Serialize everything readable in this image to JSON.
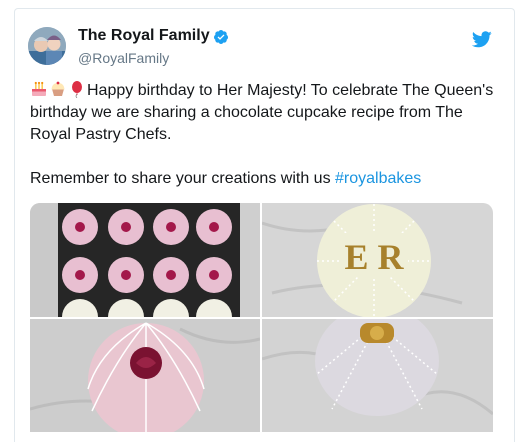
{
  "tweet": {
    "display_name": "The Royal Family",
    "handle": "@RoyalFamily",
    "text_line1": "Happy birthday to Her Majesty! To celebrate The Queen's birthday we are sharing a chocolate cupcake recipe from The Royal Pastry Chefs.",
    "text_line2_prefix": "Remember to share your creations with us ",
    "hashtag": "#royalbakes",
    "emojis": [
      "birthday-cake-emoji",
      "cupcake-emoji",
      "balloon-emoji"
    ]
  },
  "photo_text": {
    "cipher": "E R"
  },
  "icons": {
    "verified": "verified-badge-icon",
    "twitter": "twitter-bird-icon"
  },
  "colors": {
    "link": "#1b95e0",
    "verified": "#1da1f2",
    "text": "#14171a",
    "secondary": "#657786"
  }
}
